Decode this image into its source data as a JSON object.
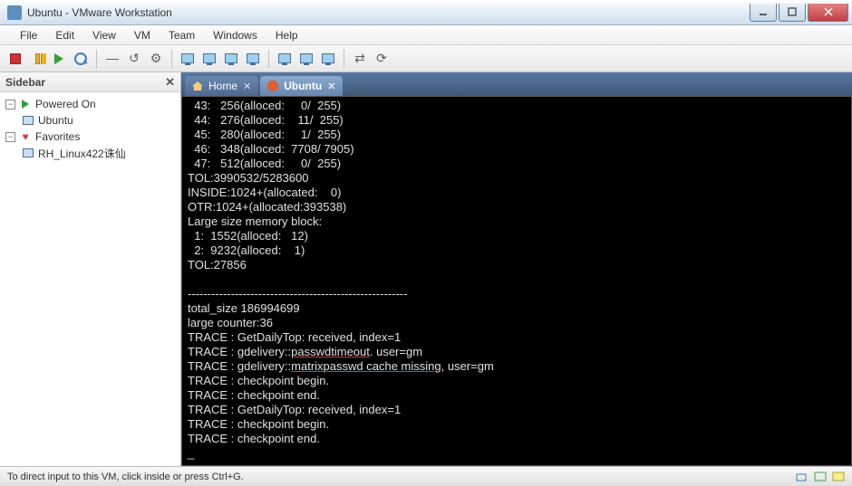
{
  "window": {
    "title": "Ubuntu - VMware Workstation"
  },
  "menubar": [
    "File",
    "Edit",
    "View",
    "VM",
    "Team",
    "Windows",
    "Help"
  ],
  "sidebar": {
    "title": "Sidebar",
    "groups": [
      {
        "label": "Powered On",
        "expanded": true,
        "children": [
          {
            "label": "Ubuntu"
          }
        ]
      },
      {
        "label": "Favorites",
        "expanded": true,
        "children": [
          {
            "label": "RH_Linux422诛仙"
          }
        ]
      }
    ]
  },
  "tabs": [
    {
      "label": "Home",
      "active": false
    },
    {
      "label": "Ubuntu",
      "active": true
    }
  ],
  "terminal_lines": [
    "  43:   256(alloced:     0/  255)",
    "  44:   276(alloced:    11/  255)",
    "  45:   280(alloced:     1/  255)",
    "  46:   348(alloced:  7708/ 7905)",
    "  47:   512(alloced:     0/  255)",
    "TOL:3990532/5283600",
    "INSIDE:1024+(allocated:    0)",
    "OTR:1024+(allocated:393538)",
    "Large size memory block:",
    "  1:  1552(alloced:   12)",
    "  2:  9232(alloced:    1)",
    "TOL:27856",
    "",
    "--------------------------------------------------------",
    "total_size 186994699",
    "large counter:36",
    "TRACE : GetDailyTop: received, index=1",
    {
      "parts": [
        "TRACE : gdelivery::",
        {
          "u": "passwdtimeout"
        },
        ". user=gm"
      ]
    },
    {
      "parts": [
        "TRACE : gdelivery::",
        {
          "u": "matrixpasswd cache missing"
        },
        ", user=gm"
      ]
    },
    "TRACE : checkpoint begin.",
    "TRACE : checkpoint end.",
    "TRACE : GetDailyTop: received, index=1",
    "TRACE : checkpoint begin.",
    "TRACE : checkpoint end.",
    "_"
  ],
  "statusbar": {
    "hint": "To direct input to this VM, click inside or press Ctrl+G."
  }
}
